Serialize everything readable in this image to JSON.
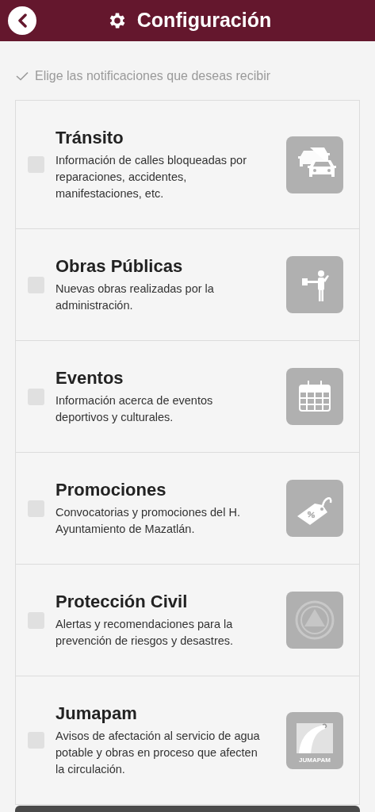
{
  "header": {
    "title": "Configuración"
  },
  "instruction": "Elige las notificaciones que deseas recibir",
  "items": [
    {
      "title": "Tránsito",
      "description": "Información de calles bloqueadas por reparaciones, accidentes, manifestaciones, etc.",
      "checked": false
    },
    {
      "title": "Obras Públicas",
      "description": "Nuevas obras realizadas por la administración.",
      "checked": false
    },
    {
      "title": "Eventos",
      "description": "Información acerca de eventos deportivos y culturales.",
      "checked": false
    },
    {
      "title": "Promociones",
      "description": "Convocatorias y promociones del H. Ayuntamiento de Mazatlán.",
      "checked": false
    },
    {
      "title": "Protección Civil",
      "description": "Alertas y recomendaciones para la prevención de riesgos y desastres.",
      "checked": false
    },
    {
      "title": "Jumapam",
      "description": "Avisos de afectación al servicio de agua potable y obras en proceso que afecten la circulación.",
      "checked": false,
      "icon_text": "JUMAPAM"
    }
  ]
}
